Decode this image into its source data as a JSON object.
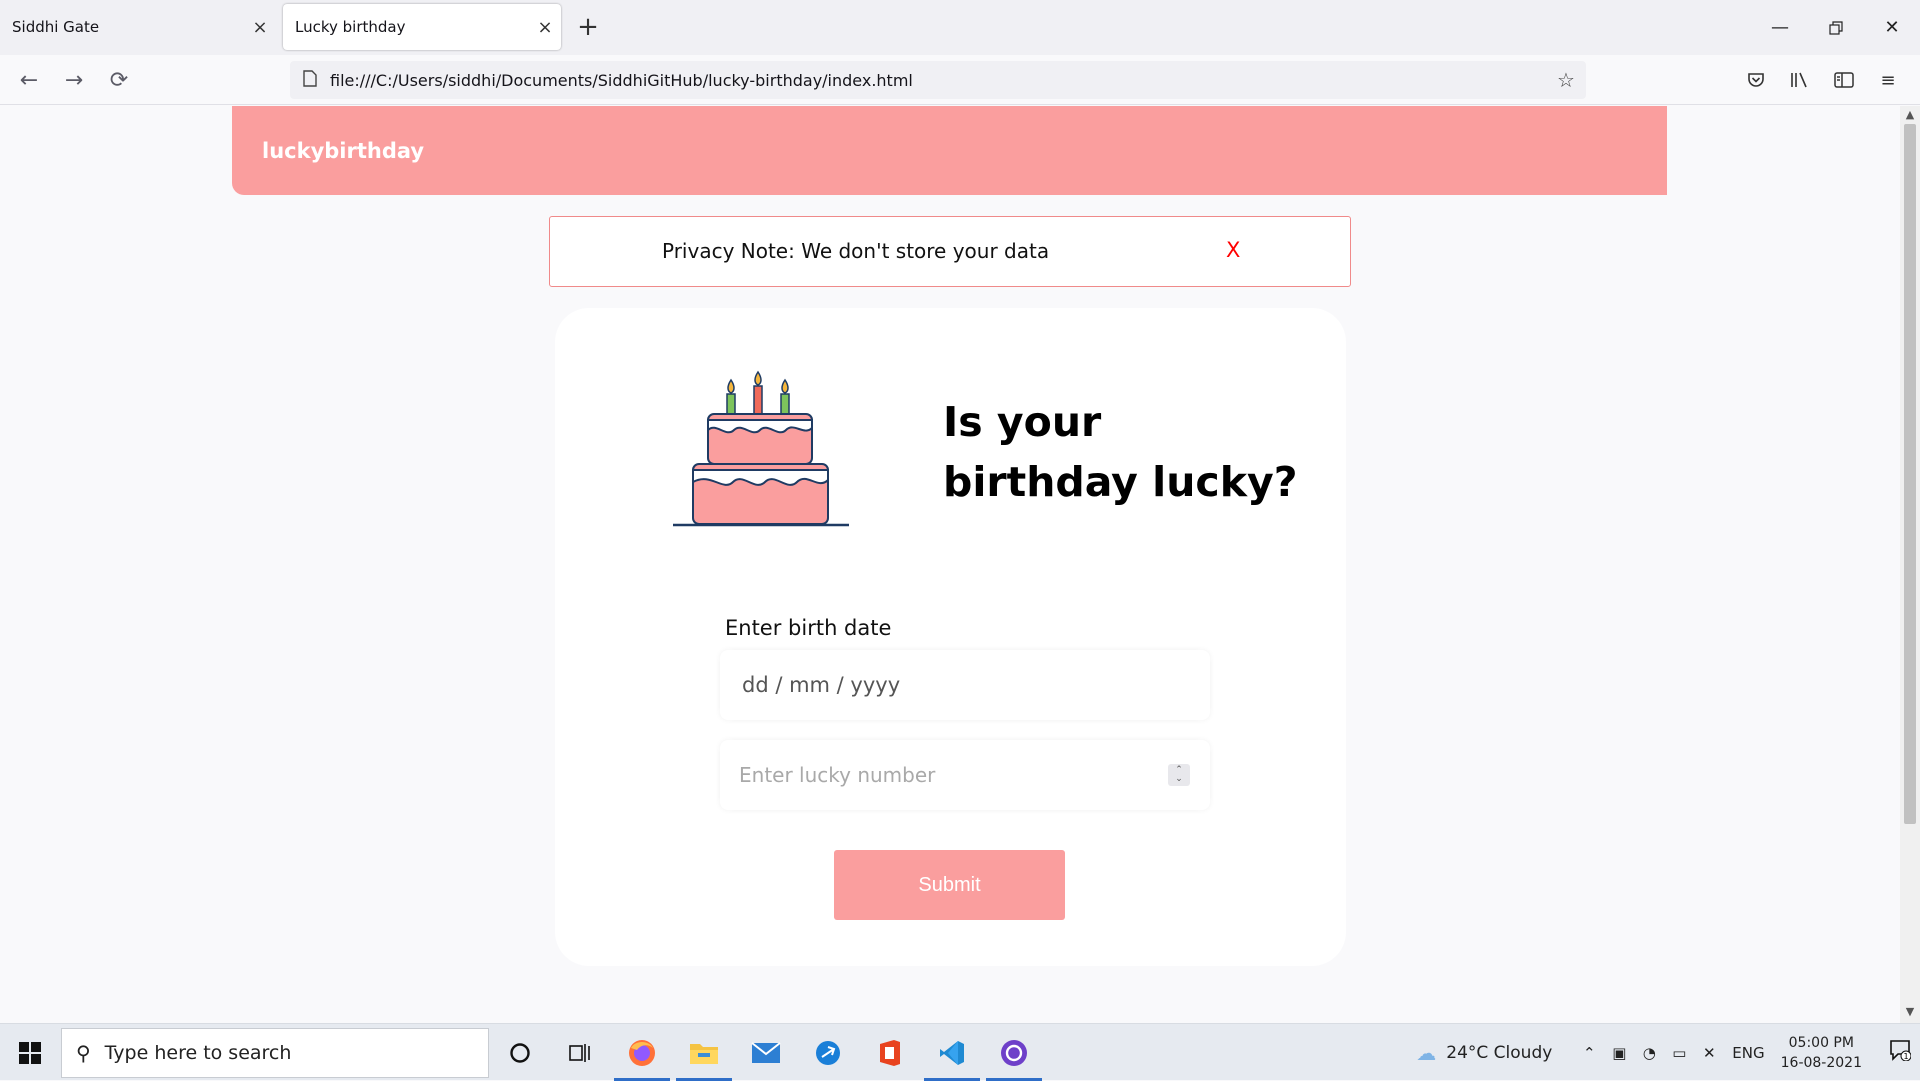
{
  "browser": {
    "tabs": [
      {
        "label": "Siddhi Gate",
        "active": false
      },
      {
        "label": "Lucky birthday",
        "active": true
      }
    ],
    "new_tab_icon": "plus-icon",
    "url": "file:///C:/Users/siddhi/Documents/SiddhiGitHub/lucky-birthday/index.html"
  },
  "site": {
    "logo": "luckybirthday",
    "privacy_note": "Privacy Note: We don't store your data",
    "privacy_close": "X",
    "heading": "Is your birthday lucky?",
    "form": {
      "birth_date_label": "Enter birth date",
      "date_placeholder": "dd / mm / yyyy",
      "lucky_number_placeholder": "Enter lucky number",
      "submit_label": "Submit"
    }
  },
  "taskbar": {
    "search_placeholder": "Type here to search",
    "weather": "24°C  Cloudy",
    "language": "ENG",
    "time": "05:00 PM",
    "date": "16-08-2021",
    "notification_count": "1"
  },
  "colors": {
    "brand_pink": "#fa9e9e",
    "close_red": "#ff0000"
  }
}
